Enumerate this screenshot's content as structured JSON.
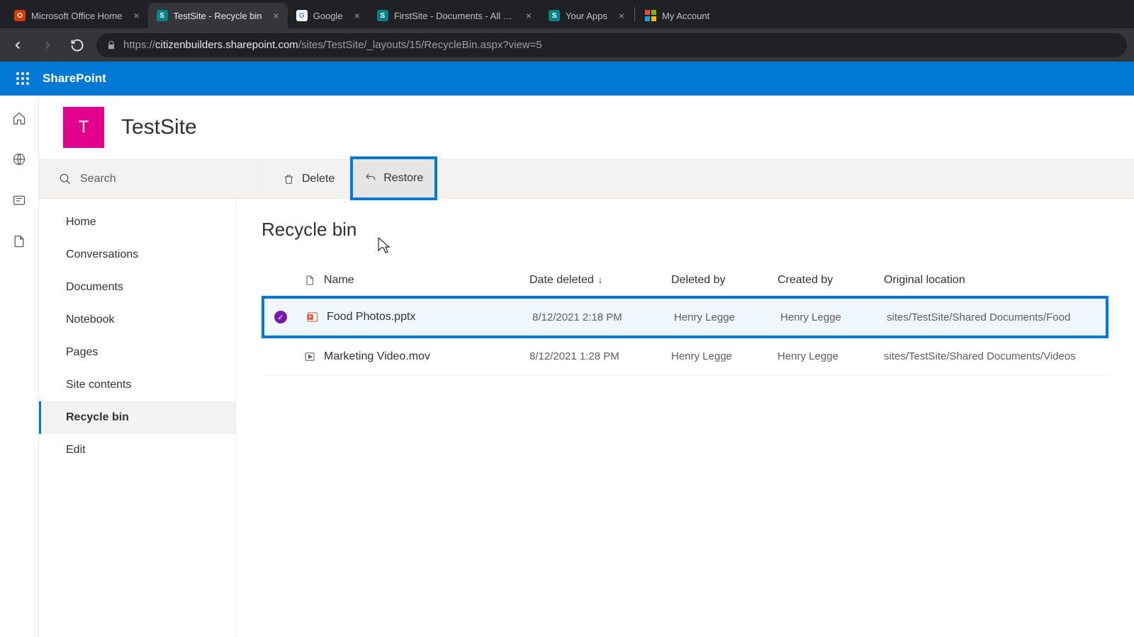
{
  "browser": {
    "tabs": [
      {
        "title": "Microsoft Office Home",
        "favicon_bg": "#d83b01",
        "favicon_text": ""
      },
      {
        "title": "TestSite - Recycle bin",
        "favicon_bg": "#038387",
        "favicon_text": "S",
        "active": true
      },
      {
        "title": "Google",
        "favicon_bg": "#ffffff",
        "favicon_text": "G"
      },
      {
        "title": "FirstSite - Documents - All Docum",
        "favicon_bg": "#038387",
        "favicon_text": "S"
      },
      {
        "title": "Your Apps",
        "favicon_bg": "#038387",
        "favicon_text": "S"
      },
      {
        "title": "My Account",
        "favicon_bg": "",
        "favicon_text": ""
      }
    ],
    "url_host": "citizenbuilders.sharepoint.com",
    "url_path": "/sites/TestSite/_layouts/15/RecycleBin.aspx?view=5"
  },
  "suite": {
    "brand": "SharePoint"
  },
  "site": {
    "logo_letter": "T",
    "title": "TestSite"
  },
  "search": {
    "placeholder": "Search"
  },
  "commands": {
    "delete": "Delete",
    "restore": "Restore"
  },
  "leftnav": {
    "items": [
      "Home",
      "Conversations",
      "Documents",
      "Notebook",
      "Pages",
      "Site contents",
      "Recycle bin",
      "Edit"
    ],
    "active_index": 6
  },
  "page": {
    "title": "Recycle bin"
  },
  "columns": {
    "name": "Name",
    "date_deleted": "Date deleted",
    "deleted_by": "Deleted by",
    "created_by": "Created by",
    "original_location": "Original location"
  },
  "rows": [
    {
      "selected": true,
      "icon": "pptx",
      "name": "Food Photos.pptx",
      "date_deleted": "8/12/2021 2:18 PM",
      "deleted_by": "Henry Legge",
      "created_by": "Henry Legge",
      "original_location": "sites/TestSite/Shared Documents/Food"
    },
    {
      "selected": false,
      "icon": "video",
      "name": "Marketing Video.mov",
      "date_deleted": "8/12/2021 1:28 PM",
      "deleted_by": "Henry Legge",
      "created_by": "Henry Legge",
      "original_location": "sites/TestSite/Shared Documents/Videos"
    }
  ]
}
